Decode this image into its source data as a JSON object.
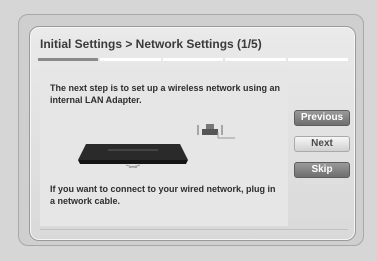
{
  "dialog": {
    "title": "Initial Settings > Network Settings (1/5)",
    "progress_steps": 5,
    "current_step": 1,
    "instruction_text": "The next step is to set up a wireless network using an internal LAN Adapter.",
    "wired_hint_text": "If you want to connect to your wired network, plug in a network cable."
  },
  "buttons": {
    "previous_label": "Previous",
    "next_label": "Next",
    "skip_label": "Skip"
  },
  "colors": {
    "focused_button": "#7d7d7d",
    "dialog_background": "#e2e2e2"
  },
  "icons": {
    "player": "bluray-player-icon",
    "cable": "lan-cable-icon"
  }
}
